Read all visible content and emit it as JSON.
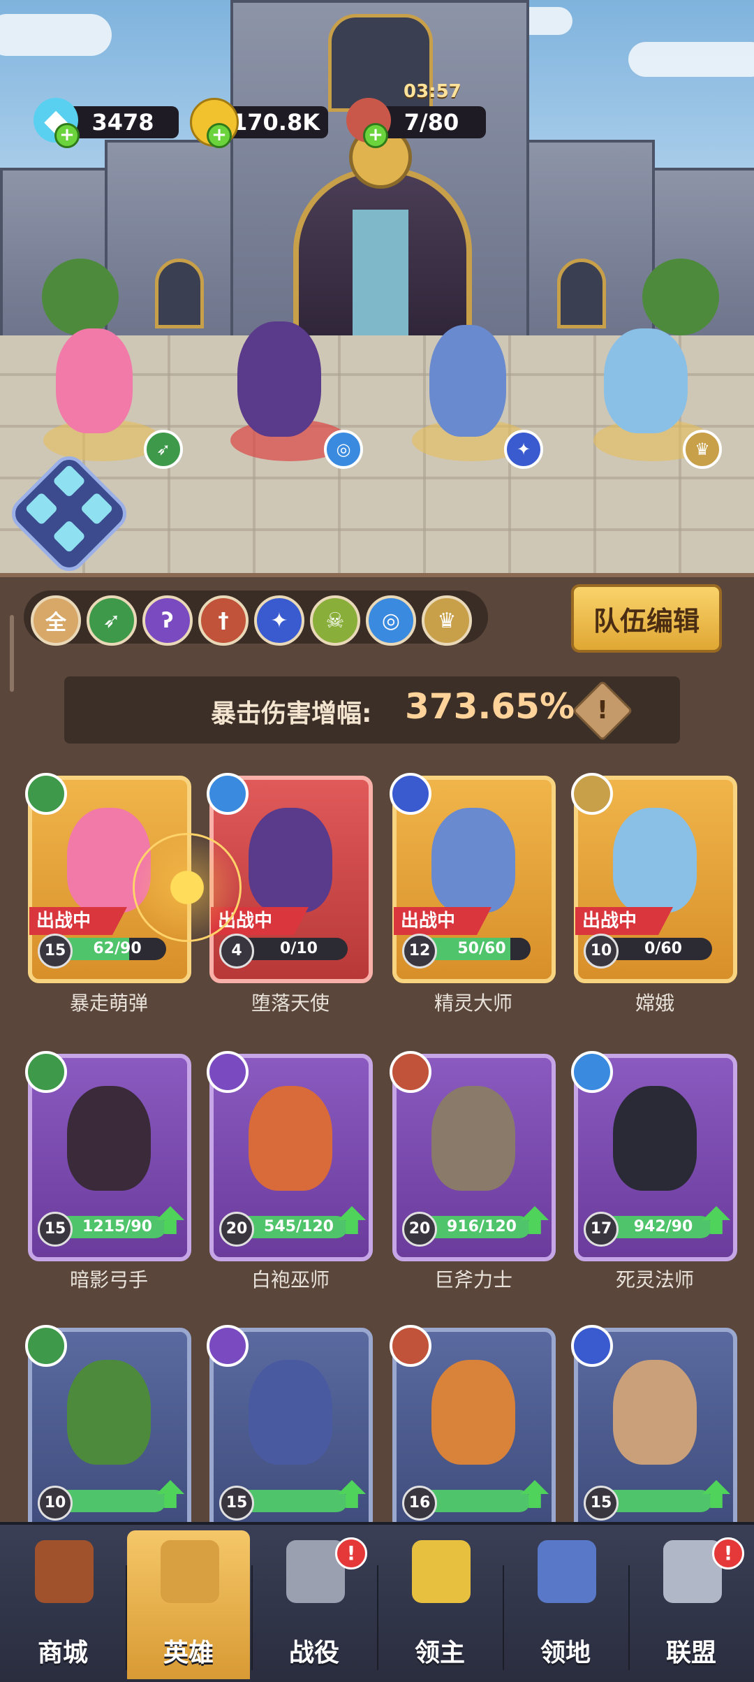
{
  "resources": {
    "gems": "3478",
    "gold": "170.8K",
    "stamina": "7/80",
    "stamina_timer": "03:57"
  },
  "filters": [
    {
      "label": "全",
      "icon": "all-filter",
      "color": "#d8a868"
    },
    {
      "label": "➶",
      "icon": "bow-icon",
      "color": "#3e9a4a"
    },
    {
      "label": "ʔ",
      "icon": "staff-icon",
      "color": "#7a4ac0"
    },
    {
      "label": "†",
      "icon": "sword-icon",
      "color": "#c0533a"
    },
    {
      "label": "✦",
      "icon": "paw-icon",
      "color": "#3a5ad0"
    },
    {
      "label": "☠",
      "icon": "skull-icon",
      "color": "#8aae3a"
    },
    {
      "label": "◎",
      "icon": "swirl-icon",
      "color": "#3a8ae0"
    },
    {
      "label": "♛",
      "icon": "crown-icon",
      "color": "#c9a04a"
    }
  ],
  "team_edit_label": "队伍编辑",
  "crit": {
    "label": "暴击伤害增幅:",
    "value": "373.65%",
    "info_label": "!"
  },
  "deployed_label": "出战中",
  "heroes": [
    {
      "name": "暴走萌弹",
      "level": "15",
      "progress_text": "62/90",
      "progress": 0.69,
      "class_icon": "bow-icon",
      "class_color": "#3e9a4a",
      "deployed": true,
      "card": "gold",
      "figure_color": "#f27aa8"
    },
    {
      "name": "堕落天使",
      "level": "4",
      "progress_text": "0/10",
      "progress": 0,
      "class_icon": "swirl-icon",
      "class_color": "#3a8ae0",
      "deployed": true,
      "card": "red",
      "figure_color": "#5a3a8a"
    },
    {
      "name": "精灵大师",
      "level": "12",
      "progress_text": "50/60",
      "progress": 0.83,
      "class_icon": "paw-icon",
      "class_color": "#3a5ad0",
      "deployed": true,
      "card": "gold",
      "figure_color": "#6a8ad0"
    },
    {
      "name": "嫦娥",
      "level": "10",
      "progress_text": "0/60",
      "progress": 0,
      "class_icon": "crown-icon",
      "class_color": "#c9a04a",
      "deployed": true,
      "card": "gold",
      "figure_color": "#8ac0e6"
    },
    {
      "name": "暗影弓手",
      "level": "15",
      "progress_text": "1215/90",
      "progress": 1,
      "class_icon": "bow-icon",
      "class_color": "#3e9a4a",
      "deployed": false,
      "card": "purple",
      "figure_color": "#3a2a3a",
      "upgradable": true
    },
    {
      "name": "白袍巫师",
      "level": "20",
      "progress_text": "545/120",
      "progress": 1,
      "class_icon": "staff-icon",
      "class_color": "#7a4ac0",
      "deployed": false,
      "card": "purple",
      "figure_color": "#d96a3a",
      "upgradable": true
    },
    {
      "name": "巨斧力士",
      "level": "20",
      "progress_text": "916/120",
      "progress": 1,
      "class_icon": "sword-icon",
      "class_color": "#c0533a",
      "deployed": false,
      "card": "purple",
      "figure_color": "#8a7a6a",
      "upgradable": true
    },
    {
      "name": "死灵法师",
      "level": "17",
      "progress_text": "942/90",
      "progress": 1,
      "class_icon": "swirl-icon",
      "class_color": "#3a8ae0",
      "deployed": false,
      "card": "purple",
      "figure_color": "#2a2a36",
      "upgradable": true
    },
    {
      "name": "",
      "level": "10",
      "progress_text": "",
      "progress": 1,
      "class_icon": "bow-icon",
      "class_color": "#3e9a4a",
      "deployed": false,
      "card": "blue",
      "figure_color": "#4e8a3c",
      "upgradable": true
    },
    {
      "name": "",
      "level": "15",
      "progress_text": "",
      "progress": 1,
      "class_icon": "staff-icon",
      "class_color": "#7a4ac0",
      "deployed": false,
      "card": "blue",
      "figure_color": "#4a5aa0",
      "upgradable": true
    },
    {
      "name": "",
      "level": "16",
      "progress_text": "",
      "progress": 1,
      "class_icon": "sword-icon",
      "class_color": "#c0533a",
      "deployed": false,
      "card": "blue",
      "figure_color": "#d9833a",
      "upgradable": true
    },
    {
      "name": "",
      "level": "15",
      "progress_text": "",
      "progress": 1,
      "class_icon": "paw-icon",
      "class_color": "#3a5ad0",
      "deployed": false,
      "card": "blue",
      "figure_color": "#c9a07a",
      "upgradable": true
    }
  ],
  "nav": [
    {
      "label": "商城",
      "icon": "shop-chest-icon",
      "active": false,
      "alert": false
    },
    {
      "label": "英雄",
      "icon": "hero-cards-icon",
      "active": true,
      "alert": false
    },
    {
      "label": "战役",
      "icon": "crossed-swords-icon",
      "active": false,
      "alert": true
    },
    {
      "label": "领主",
      "icon": "lord-crown-icon",
      "active": false,
      "alert": false
    },
    {
      "label": "领地",
      "icon": "castle-icon",
      "active": false,
      "alert": false
    },
    {
      "label": "联盟",
      "icon": "knight-helmet-icon",
      "active": false,
      "alert": true
    }
  ],
  "alert_mark": "!"
}
